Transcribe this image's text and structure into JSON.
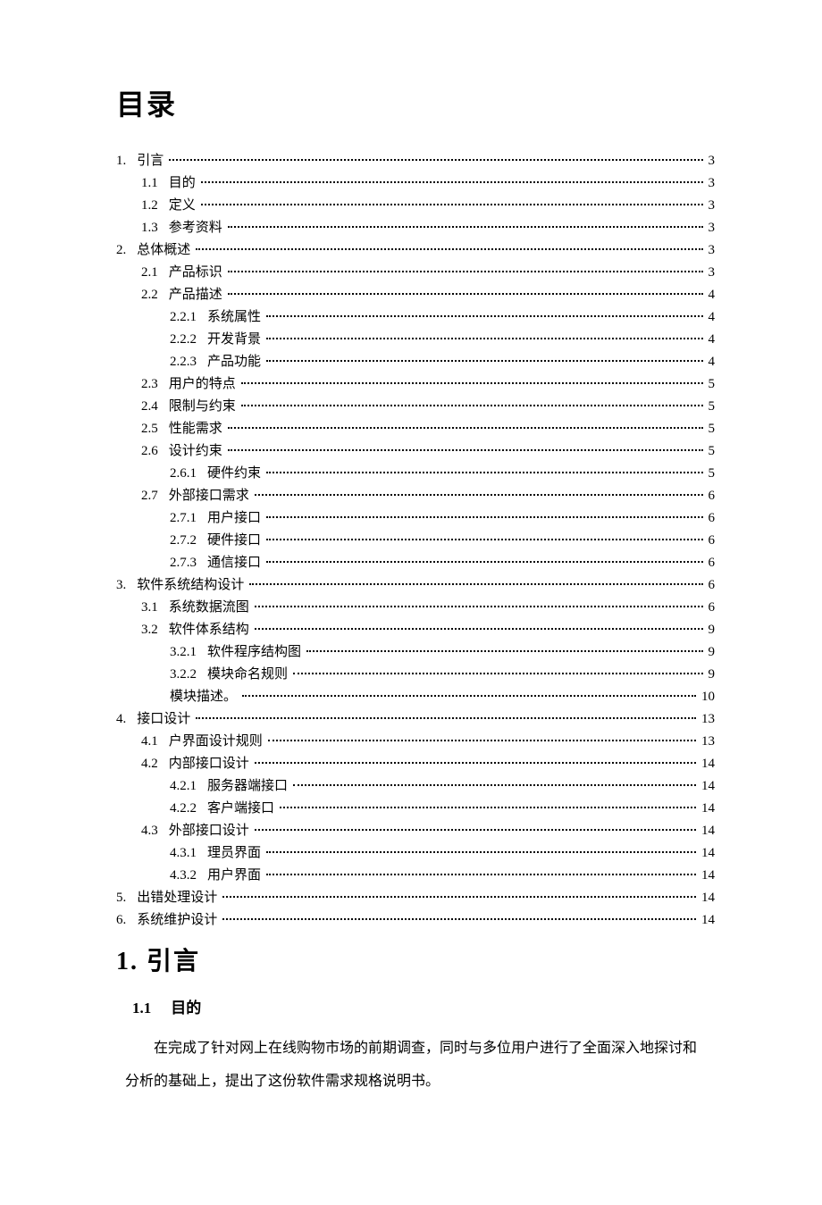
{
  "title": "目录",
  "toc": [
    {
      "level": 0,
      "num": "1.",
      "label": "引言",
      "page": "3"
    },
    {
      "level": 1,
      "num": "1.1",
      "label": "目的",
      "page": "3"
    },
    {
      "level": 1,
      "num": "1.2",
      "label": "定义",
      "page": "3"
    },
    {
      "level": 1,
      "num": "1.3",
      "label": "参考资料",
      "page": "3"
    },
    {
      "level": 0,
      "num": "2.",
      "label": "总体概述",
      "page": "3"
    },
    {
      "level": 1,
      "num": "2.1",
      "label": "产品标识",
      "page": "3"
    },
    {
      "level": 1,
      "num": "2.2",
      "label": "产品描述",
      "page": "4"
    },
    {
      "level": 2,
      "num": "2.2.1",
      "label": "系统属性",
      "page": "4"
    },
    {
      "level": 2,
      "num": "2.2.2",
      "label": "开发背景",
      "page": "4"
    },
    {
      "level": 2,
      "num": "2.2.3",
      "label": "产品功能",
      "page": "4"
    },
    {
      "level": 1,
      "num": "2.3",
      "label": "用户的特点",
      "page": "5"
    },
    {
      "level": 1,
      "num": "2.4",
      "label": "限制与约束",
      "page": "5"
    },
    {
      "level": 1,
      "num": "2.5",
      "label": "性能需求",
      "page": "5"
    },
    {
      "level": 1,
      "num": "2.6",
      "label": "设计约束",
      "page": "5"
    },
    {
      "level": 2,
      "num": "2.6.1",
      "label": "硬件约束",
      "page": "5"
    },
    {
      "level": 1,
      "num": "2.7",
      "label": "外部接口需求",
      "page": "6"
    },
    {
      "level": 2,
      "num": "2.7.1",
      "label": "用户接口",
      "page": "6"
    },
    {
      "level": 2,
      "num": "2.7.2",
      "label": "硬件接口",
      "page": "6"
    },
    {
      "level": 2,
      "num": "2.7.3",
      "label": "通信接口",
      "page": "6"
    },
    {
      "level": 0,
      "num": "3.",
      "label": "软件系统结构设计",
      "page": "6"
    },
    {
      "level": 1,
      "num": "3.1",
      "label": "系统数据流图",
      "page": "6"
    },
    {
      "level": 1,
      "num": "3.2",
      "label": "软件体系结构",
      "page": "9"
    },
    {
      "level": 2,
      "num": "3.2.1",
      "label": "软件程序结构图",
      "page": "9"
    },
    {
      "level": 2,
      "num": "3.2.2",
      "label": "模块命名规则",
      "page": "9"
    },
    {
      "level": 2,
      "num": "",
      "label": "模块描述。",
      "page": "10"
    },
    {
      "level": 0,
      "num": "4.",
      "label": "接口设计",
      "page": "13"
    },
    {
      "level": 1,
      "num": "4.1",
      "label": "户界面设计规则",
      "page": "13"
    },
    {
      "level": 1,
      "num": "4.2",
      "label": "内部接口设计",
      "page": "14"
    },
    {
      "level": 2,
      "num": "4.2.1",
      "label": "服务器端接口",
      "page": "14"
    },
    {
      "level": 2,
      "num": "4.2.2",
      "label": "客户端接口",
      "page": "14"
    },
    {
      "level": 1,
      "num": "4.3",
      "label": "外部接口设计",
      "page": "14"
    },
    {
      "level": 2,
      "num": "4.3.1",
      "label": "理员界面",
      "page": "14"
    },
    {
      "level": 2,
      "num": "4.3.2",
      "label": "用户界面",
      "page": "14"
    },
    {
      "level": 0,
      "num": "5.",
      "label": "出错处理设计",
      "page": "14"
    },
    {
      "level": 0,
      "num": "6.",
      "label": "系统维护设计",
      "page": "14"
    }
  ],
  "section1": {
    "heading": "1. 引言",
    "sub_num": "1.1",
    "sub_label": "目的",
    "paragraph": "在完成了针对网上在线购物市场的前期调查，同时与多位用户进行了全面深入地探讨和分析的基础上，提出了这份软件需求规格说明书。"
  }
}
